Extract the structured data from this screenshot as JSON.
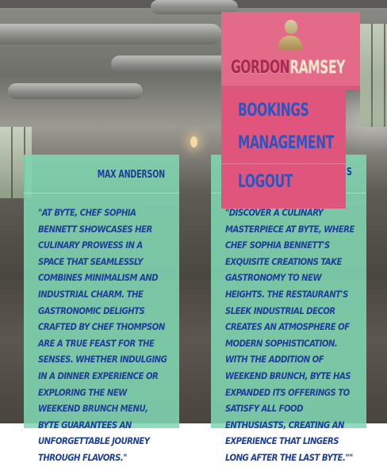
{
  "brand": {
    "part1": "GORDON",
    "part2": "RAMSEY"
  },
  "nav": {
    "items": [
      {
        "label": "BOOKINGS"
      },
      {
        "label": "MANAGEMENT"
      },
      {
        "label": "LOGOUT"
      }
    ]
  },
  "cards": [
    {
      "name": "MAX ANDERSON",
      "quote": "\"AT BYTE, CHEF SOPHIA BENNETT SHOWCASES HER CULINARY PROWESS IN A SPACE THAT SEAMLESSLY COMBINES MINIMALISM AND INDUSTRIAL CHARM. THE GASTRONOMIC DELIGHTS CRAFTED BY CHEF THOMPSON ARE A TRUE FEAST FOR THE SENSES. WHETHER INDULGING IN A DINNER EXPERIENCE OR EXPLORING THE NEW WEEKEND BRUNCH MENU, BYTE GUARANTEES AN UNFORGETTABLE JOURNEY THROUGH FLAVORS.\""
    },
    {
      "name_peek": "S",
      "quote": "\"DISCOVER A CULINARY MASTERPIECE AT BYTE, WHERE CHEF SOPHIA BENNETT'S EXQUISITE CREATIONS TAKE GASTRONOMY TO NEW HEIGHTS. THE RESTAURANT'S SLEEK INDUSTRIAL DECOR CREATES AN ATMOSPHERE OF MODERN SOPHISTICATION. WITH THE ADDITION OF WEEKEND BRUNCH, BYTE HAS EXPANDED ITS OFFERINGS TO SATISFY ALL FOOD ENTHUSIASTS, CREATING AN EXPERIENCE THAT LINGERS LONG AFTER THE LAST BYTE.\"\""
    }
  ],
  "icons": {
    "avatar": "user-avatar-icon"
  },
  "colors": {
    "menu_pink": "#e46a8a",
    "menu_link": "#2a56c4",
    "card_green": "#80d6b2",
    "card_text": "#1f3f9a"
  }
}
